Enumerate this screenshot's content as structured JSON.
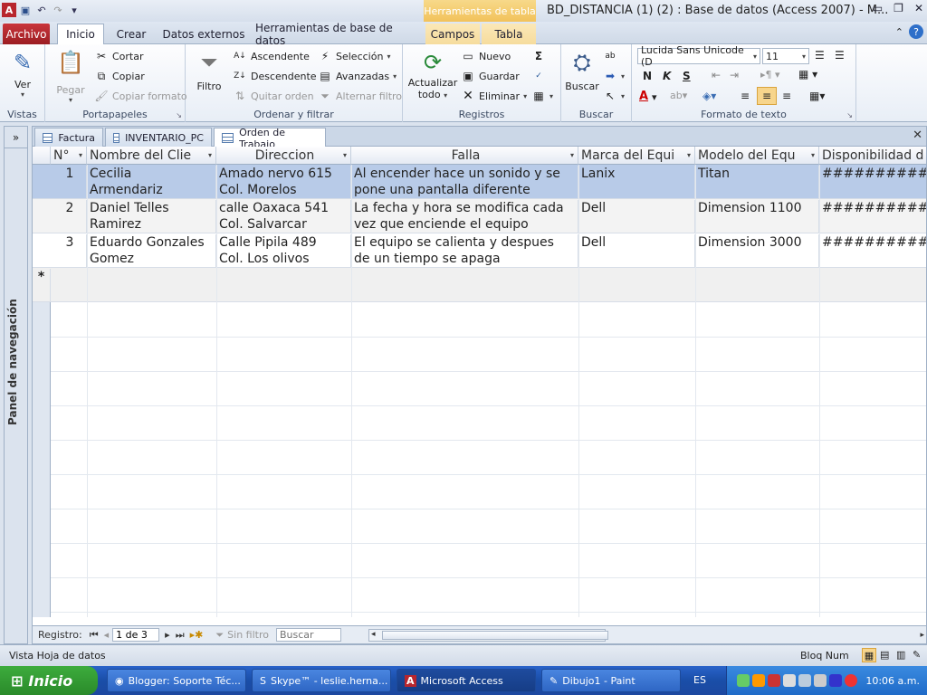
{
  "titlebar": {
    "context_group": "Herramientas de tabla",
    "title": "BD_DISTANCIA (1) (2) : Base de datos (Access 2007)  -  M...",
    "app_icon": "access-icon"
  },
  "ribbon_tabs": [
    "Archivo",
    "Inicio",
    "Crear",
    "Datos externos",
    "Herramientas de base de datos",
    "Campos",
    "Tabla"
  ],
  "ribbon": {
    "vistas": {
      "label": "Vistas",
      "ver": "Ver"
    },
    "portapapeles": {
      "label": "Portapapeles",
      "pegar": "Pegar",
      "cortar": "Cortar",
      "copiar": "Copiar",
      "copiar_formato": "Copiar formato"
    },
    "ordenar": {
      "label": "Ordenar y filtrar",
      "filtro": "Filtro",
      "ascendente": "Ascendente",
      "descendente": "Descendente",
      "quitar_orden": "Quitar orden",
      "seleccion": "Selección",
      "avanzadas": "Avanzadas",
      "alternar_filtro": "Alternar filtro"
    },
    "registros": {
      "label": "Registros",
      "actualizar": "Actualizar",
      "todo": "todo",
      "nuevo": "Nuevo",
      "guardar": "Guardar",
      "eliminar": "Eliminar"
    },
    "buscar": {
      "label": "Buscar",
      "buscar": "Buscar"
    },
    "formato": {
      "label": "Formato de texto",
      "font": "Lucida Sans Unicode (D",
      "size": "11",
      "bold": "N",
      "italic": "K",
      "underline": "S"
    }
  },
  "nav_pane": {
    "label": "Panel de navegación",
    "toggle": "»"
  },
  "doc_tabs": [
    "Factura",
    "INVENTARIO_PC",
    "Orden de Trabajo"
  ],
  "columns": [
    "N°",
    "Nombre del Clie",
    "Direccion",
    "Falla",
    "Marca del Equi",
    "Modelo del Equ",
    "Disponibilidad d"
  ],
  "rows": [
    {
      "n": "1",
      "nombre": "Cecilia\nArmendariz",
      "direccion": "Amado nervo 615\nCol. Morelos",
      "falla": "Al encender hace un sonido y se\npone una pantalla diferente",
      "marca": "Lanix",
      "modelo": "Titan",
      "disp": "############"
    },
    {
      "n": "2",
      "nombre": "Daniel Telles\nRamirez",
      "direccion": "calle Oaxaca 541\nCol. Salvarcar",
      "falla": "La fecha y hora se modifica cada\nvez que enciende el equipo",
      "marca": "Dell",
      "modelo": "Dimension 1100",
      "disp": "############"
    },
    {
      "n": "3",
      "nombre": "Eduardo Gonzales\nGomez",
      "direccion": "Calle Pipila 489\nCol. Los olivos",
      "falla": "El equipo se calienta y despues\nde un tiempo se apaga",
      "marca": "Dell",
      "modelo": "Dimension 3000",
      "disp": "############"
    }
  ],
  "new_row_marker": "*",
  "record_nav": {
    "label": "Registro:",
    "position": "1 de 3",
    "filter": "Sin filtro",
    "search_placeholder": "Buscar"
  },
  "statusbar": {
    "left": "Vista Hoja de datos",
    "right": "Bloq Num"
  },
  "taskbar": {
    "start": "Inicio",
    "items": [
      "Blogger: Soporte Téc...",
      "Skype™ - leslie.herna...",
      "Microsoft Access",
      "Dibujo1 - Paint"
    ],
    "lang": "ES",
    "clock": "10:06 a.m."
  }
}
